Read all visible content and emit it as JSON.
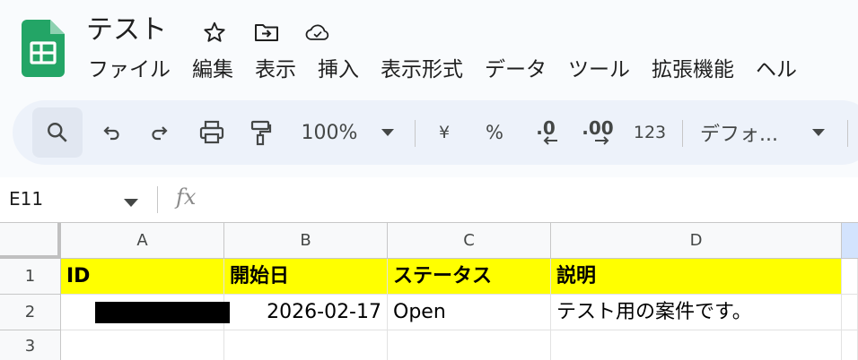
{
  "doc": {
    "title": "テスト"
  },
  "menu": [
    "ファイル",
    "編集",
    "表示",
    "挿入",
    "表示形式",
    "データ",
    "ツール",
    "拡張機能",
    "ヘル"
  ],
  "toolbar": {
    "zoom": "100%",
    "currency": "¥",
    "percent": "%",
    "decrease_decimal": ".0",
    "increase_decimal": ".00",
    "number_format": "123",
    "font": "デフォ..."
  },
  "formula_bar": {
    "cell_ref": "E11",
    "fx": "fx"
  },
  "grid": {
    "columns": [
      "A",
      "B",
      "C",
      "D"
    ],
    "rows": [
      "1",
      "2",
      "3"
    ],
    "header_row": [
      "ID",
      "開始日",
      "ステータス",
      "説明"
    ],
    "data_row": [
      "",
      "2026-02-17",
      "Open",
      "テスト用の案件です。"
    ]
  },
  "colors": {
    "logo": "#23a566",
    "header_fill": "#ffff00",
    "toolbar_bg": "#edf2fa"
  }
}
